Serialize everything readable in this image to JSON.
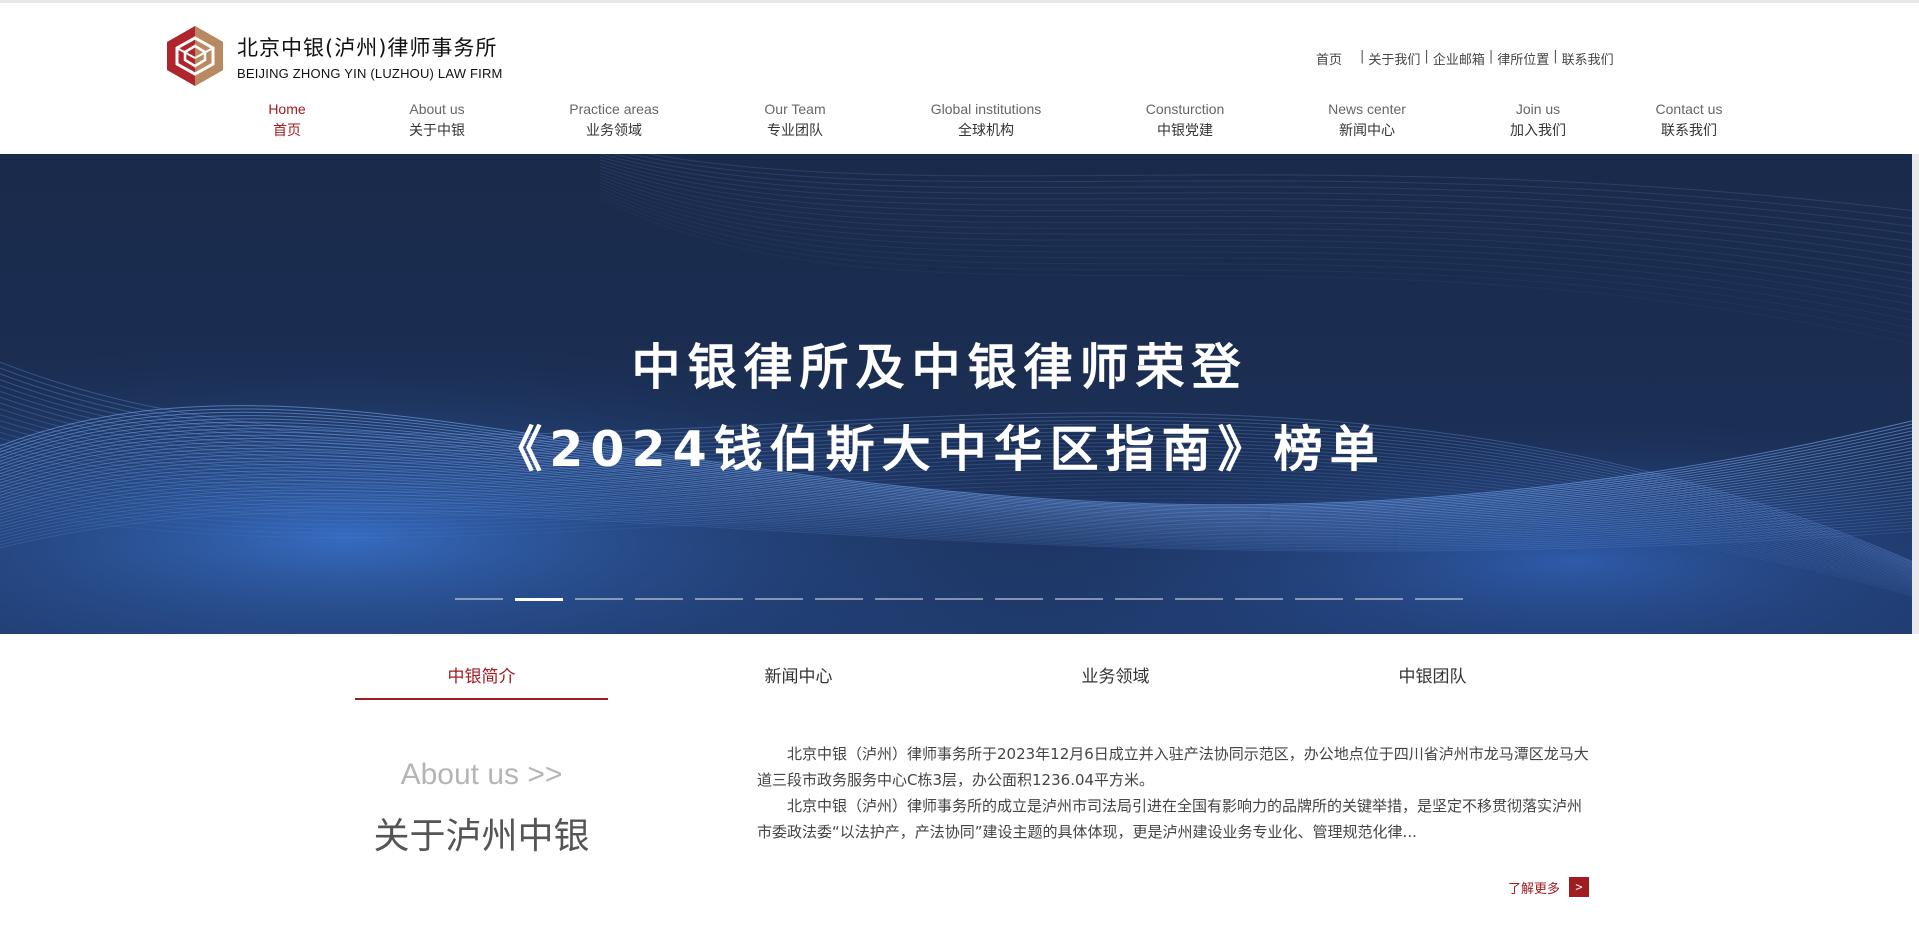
{
  "header": {
    "logo_cn": "北京中银(泸州)律师事务所",
    "logo_en": "BEIJING ZHONG YIN (LUZHOU) LAW FIRM",
    "toplinks": [
      "首页",
      "关于我们",
      "企业邮箱",
      "律所位置",
      "联系我们"
    ]
  },
  "nav": [
    {
      "en": "Home",
      "cn": "首页"
    },
    {
      "en": "About us",
      "cn": "关于中银"
    },
    {
      "en": "Practice areas",
      "cn": "业务领域"
    },
    {
      "en": "Our Team",
      "cn": "专业团队"
    },
    {
      "en": "Global institutions",
      "cn": "全球机构"
    },
    {
      "en": "Consturction",
      "cn": "中银党建"
    },
    {
      "en": "News center",
      "cn": "新闻中心"
    },
    {
      "en": "Join us",
      "cn": "加入我们"
    },
    {
      "en": "Contact us",
      "cn": "联系我们"
    }
  ],
  "banner": {
    "line1": "中银律所及中银律师荣登",
    "line2": "《2024钱伯斯大中华区指南》榜单",
    "slide_count": 17,
    "active_slide": 2
  },
  "tabs": [
    "中银简介",
    "新闻中心",
    "业务领域",
    "中银团队"
  ],
  "about": {
    "en_title": "About us >>",
    "cn_title": "关于泸州中银",
    "para1": "北京中银（泸州）律师事务所于2023年12月6日成立并入驻产法协同示范区，办公地点位于四川省泸州市龙马潭区龙马大道三段市政务服务中心C栋3层，办公面积1236.04平方米。",
    "para2": "北京中银（泸州）律师事务所的成立是泸州市司法局引进在全国有影响力的品牌所的关键举措，是坚定不移贯彻落实泸州市委政法委“以法护产，产法协同”建设主题的具体体现，更是泸州建设业务专业化、管理规范化律...",
    "more_label": "了解更多",
    "more_arrow": ">"
  },
  "colors": {
    "accent": "#a11c20",
    "banner_bg": "#17284a",
    "logo_red": "#b0242b",
    "logo_bronze": "#b98a62"
  }
}
